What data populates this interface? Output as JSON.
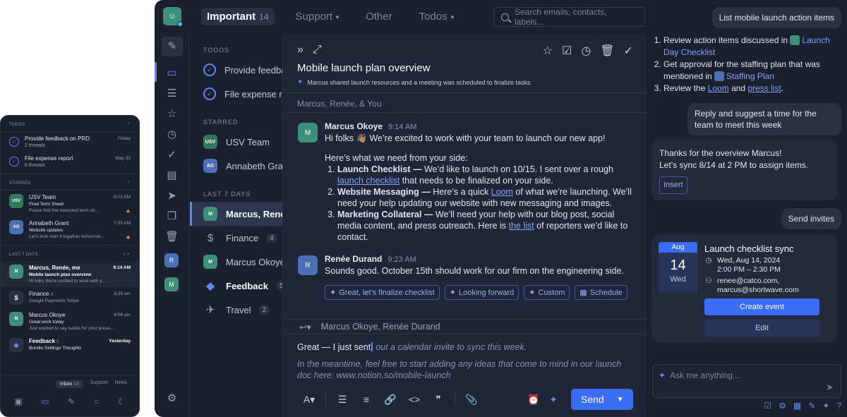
{
  "mobile": {
    "todos_header": "TODOS",
    "todos": [
      {
        "title": "Provide feedback on PRD",
        "sub": "2 threads",
        "date": "Friday"
      },
      {
        "title": "File expense report",
        "sub": "6 threads",
        "date": "May 30"
      }
    ],
    "starred_header": "STARRED",
    "starred": [
      {
        "avatar": "USV",
        "title": "USV Team",
        "sub": "Final Term Sheet",
        "preview": "Pease find the executed term sh...",
        "date": "8:22 AM"
      },
      {
        "avatar": "AG",
        "title": "Annabeth Grant",
        "sub": "Website updates",
        "preview": "Let's look over it together tomorrow...",
        "date": "7:03 AM"
      }
    ],
    "last7_header": "LAST 7 DAYS",
    "recent": [
      {
        "title": "Marcus, Renée, me",
        "sub": "Mobile launch plan overview",
        "preview": "Hi folks We're excited to work with y...",
        "date": "9:14 AM"
      },
      {
        "title": "Finance",
        "count": "4",
        "sub": "Google Payments  Stripe",
        "date": "8:35 am"
      },
      {
        "title": "Marcus Okoye",
        "sub": "Great work today",
        "preview": "Just wanted to say kudos for your prese...",
        "date": "8:06 am"
      },
      {
        "title": "Feedback",
        "count": "5",
        "sub": "Bundle Settings  Thoughts",
        "date": "Yesterday"
      }
    ],
    "tabs": {
      "inbox": "Inbox",
      "inbox_count": "14",
      "support": "Support",
      "news": "News"
    }
  },
  "desktop": {
    "tabs": [
      {
        "label": "Important",
        "count": "14"
      },
      {
        "label": "Support"
      },
      {
        "label": "Other"
      },
      {
        "label": "Todos"
      }
    ],
    "search_placeholder": "Search emails, contacts, labels...",
    "list": {
      "todos_header": "TODOS",
      "todos": [
        "Provide feedback on PRD",
        "File expense report"
      ],
      "starred_header": "STARRED",
      "starred": [
        {
          "avatar": "USV",
          "label": "USV Team"
        },
        {
          "avatar": "AG",
          "label": "Annabeth Grant"
        }
      ],
      "last7_header": "LAST 7 DAYS",
      "recent": [
        {
          "label": "Marcus, Renée, me"
        },
        {
          "label": "Finance",
          "count": "4"
        },
        {
          "label": "Marcus Okoye"
        },
        {
          "label": "Feedback",
          "count": "5"
        },
        {
          "label": "Travel",
          "count": "2"
        }
      ]
    },
    "email": {
      "title": "Mobile launch plan overview",
      "summary": "Marcus shared launch resources and a meeting was scheduled to finalize tasks",
      "participants": "Marcus, Renée, & You",
      "msg1": {
        "from": "Marcus Okoye",
        "time": "9:14 AM",
        "greeting": "Hi folks 👋🏽 We’re excited to work with your team to launch our new app!",
        "intro": "Here’s what we need from your side:",
        "items": [
          {
            "title": "Launch Checklist —",
            "pre": " We’d like to launch on 10/15. I sent over a rough ",
            "link": "launch checklist",
            "post": " that needs to be finalized on your side."
          },
          {
            "title": "Website Messaging —",
            "pre": " Here’s a quick ",
            "link": "Loom",
            "post": " of what we’re launching. We’ll need your help updating our website with new messaging and images."
          },
          {
            "title": "Marketing Collateral —",
            "pre": " We’ll need your help with our blog post, social media content, and press outreach. Here is ",
            "link": "the list",
            "post": " of reporters we’d like to contact."
          }
        ]
      },
      "msg2": {
        "from": "Renée Durand",
        "time": "9:23 AM",
        "body": "Sounds good. October 15th should work for our firm on the engineering side."
      },
      "chips": [
        "Great, let’s finalize checklist",
        "Looking forward",
        "Custom",
        "Schedule"
      ],
      "reply_to": "Marcus Okoye, Renée Durand",
      "draft_typed": "Great — I just sent",
      "draft_ghost": " out a calendar invite to sync this week.",
      "draft_ghost2": "In the meantime, feel free to start adding any ideas that come to mind in our launch doc here: www.notion.so/mobile-launch",
      "send_label": "Send"
    },
    "assistant": {
      "q1": "List mobile launch action items",
      "a1_items": [
        {
          "pre": "Review action items discussed in ",
          "link": "Launch Day Checklist"
        },
        {
          "pre": "Get approval for the staffing plan that was mentioned in ",
          "link": "Staffing Plan"
        },
        {
          "pre": "Review the ",
          "link": "Loom",
          "mid": " and ",
          "link2": "press list",
          "post": "."
        }
      ],
      "q2": "Reply and suggest a time for the team to meet this week",
      "a2_line1": "Thanks for the overview Marcus!",
      "a2_line2": "Let’s sync 8/14 at 2 PM to assign items.",
      "insert_label": "Insert",
      "q3": "Send invites",
      "event": {
        "month": "Aug",
        "day": "14",
        "weekday": "Wed",
        "title": "Launch checklist sync",
        "date": "Wed, Aug 14, 2024",
        "time": "2:00 PM – 2:30 PM",
        "guest1": "renee@catco.com,",
        "guest2": "marcus@shortwave.com",
        "create_label": "Create event",
        "edit_label": "Edit"
      },
      "ask_placeholder": "Ask me anything..."
    }
  },
  "colors": {
    "accent": "#3b6cf5",
    "link": "#7fa3ff",
    "bg": "#1b1f2e",
    "panel": "#202538"
  }
}
